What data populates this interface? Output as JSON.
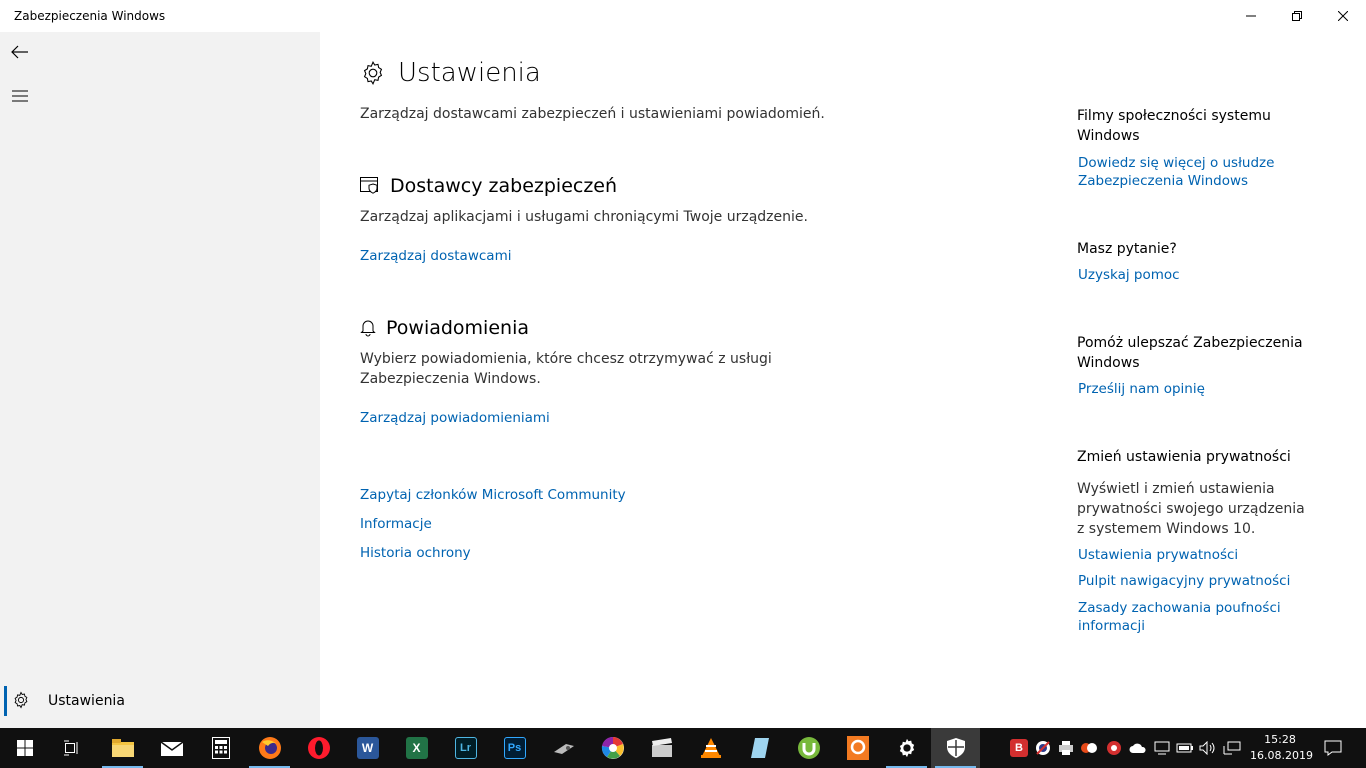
{
  "window": {
    "title": "Zabezpieczenia Windows"
  },
  "sidebar": {
    "settings_label": "Ustawienia"
  },
  "main": {
    "title": "Ustawienia",
    "subtitle": "Zarządzaj dostawcami zabezpieczeń i ustawieniami powiadomień.",
    "providers": {
      "heading": "Dostawcy zabezpieczeń",
      "description": "Zarządzaj aplikacjami i usługami chroniącymi Twoje urządzenie.",
      "link": "Zarządzaj dostawcami"
    },
    "notifications": {
      "heading": "Powiadomienia",
      "description": "Wybierz powiadomienia, które chcesz otrzymywać z usługi Zabezpieczenia Windows.",
      "link": "Zarządzaj powiadomieniami"
    },
    "bottom_links": [
      "Zapytaj członków Microsoft Community",
      "Informacje",
      "Historia ochrony"
    ]
  },
  "right": {
    "videos": {
      "heading": "Filmy społeczności systemu Windows",
      "link": "Dowiedz się więcej o usłudze Zabezpieczenia Windows"
    },
    "question": {
      "heading": "Masz pytanie?",
      "link": "Uzyskaj pomoc"
    },
    "improve": {
      "heading": "Pomóż ulepszać Zabezpieczenia Windows",
      "link": "Prześlij nam opinię"
    },
    "privacy": {
      "heading": "Zmień ustawienia prywatności",
      "description": "Wyświetl i zmień ustawienia prywatności swojego urządzenia z systemem Windows 10.",
      "links": [
        "Ustawienia prywatności",
        "Pulpit nawigacyjny prywatności",
        "Zasady zachowania poufności informacji"
      ]
    }
  },
  "taskbar": {
    "apps": [
      "start-icon",
      "task-view-icon",
      "file-explorer-icon",
      "mail-icon",
      "calculator-icon",
      "firefox-icon",
      "opera-icon",
      "word-icon",
      "excel-icon",
      "lightroom-icon",
      "photoshop-icon",
      "paint-tool-icon",
      "picasa-icon",
      "video-editor-icon",
      "vlc-icon",
      "notes-icon",
      "utorrent-icon",
      "pdf-tool-icon",
      "settings-icon",
      "windows-security-icon"
    ],
    "word_letter": "W",
    "excel_letter": "X",
    "lightroom_letter": "Lr",
    "photoshop_letter": "Ps",
    "tray_b_letter": "B",
    "time": "15:28",
    "date": "16.08.2019"
  },
  "colors": {
    "link": "#0063b1",
    "sidebar_bg": "#f2f2f2",
    "taskbar_bg": "#101010"
  }
}
